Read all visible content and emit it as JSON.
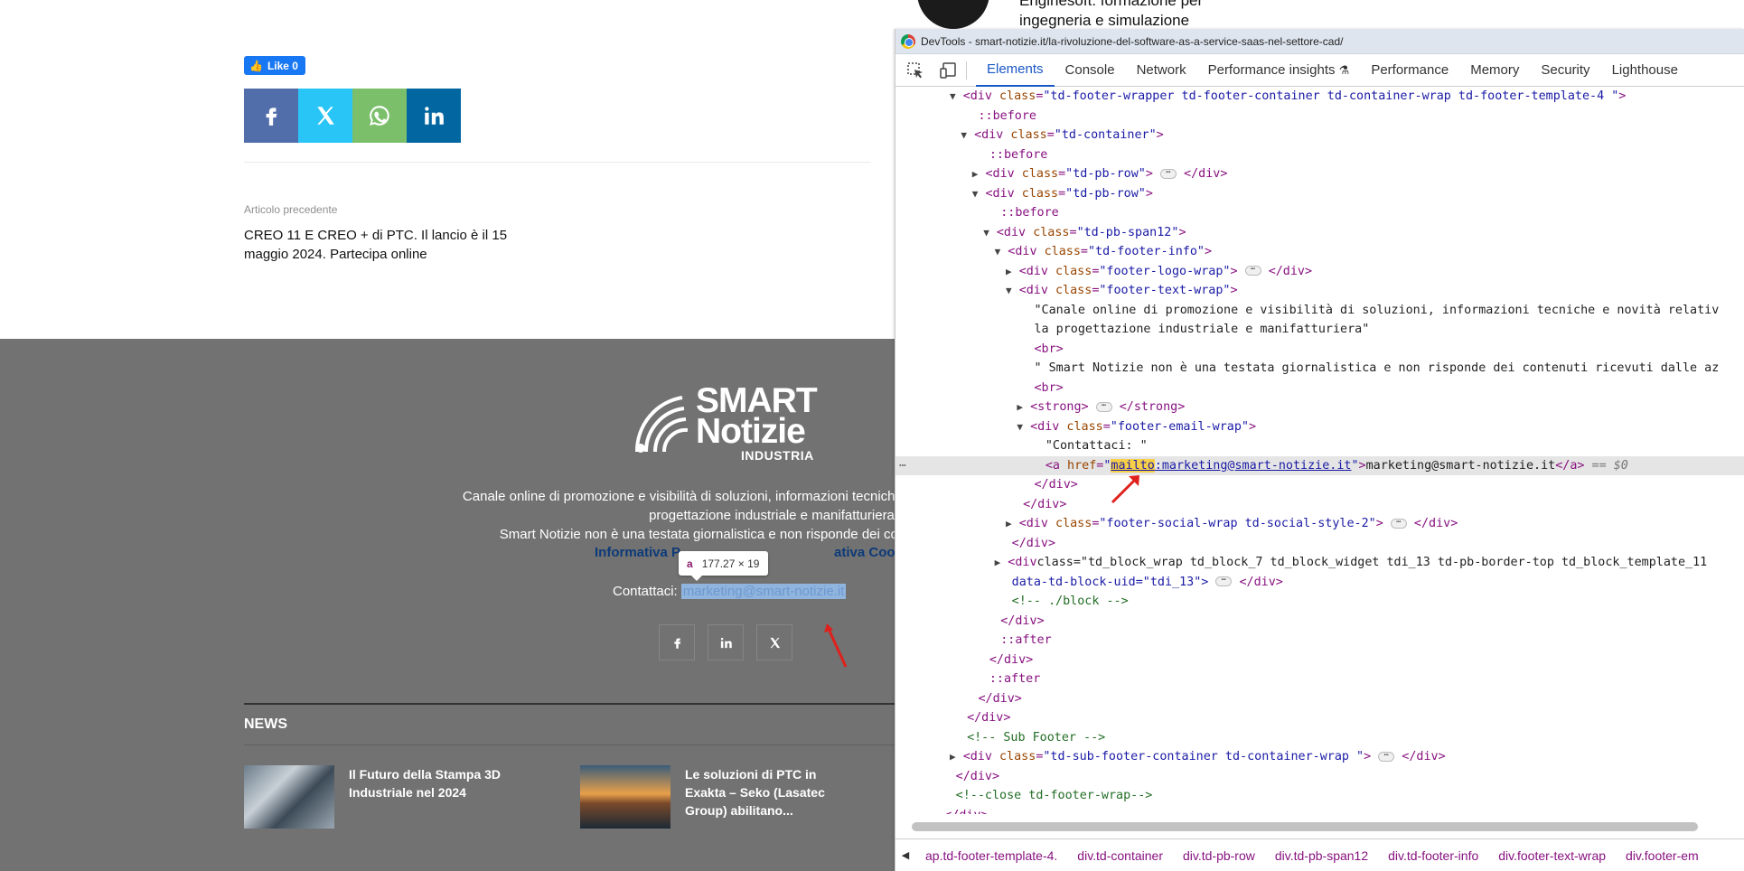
{
  "site": {
    "like_label": "Like 0",
    "prev_label": "Articolo precedente",
    "prev_title": "CREO 11 E CREO + di PTC. Il lancio è il 15 maggio 2024. Partecipa online",
    "ad_text": "Enginesoft: formazione per ingegneria e simulazione",
    "share_icons": [
      "facebook-icon",
      "x-icon",
      "whatsapp-icon",
      "linkedin-icon"
    ],
    "share_colors": [
      "#516eab",
      "#29c5f6",
      "#7bbf6a",
      "#0266a0"
    ]
  },
  "footer": {
    "logo_line1": "SMART",
    "logo_line2": "Notizie",
    "logo_line3": "INDUSTRIA",
    "line1": "Canale online di promozione e visibilità di soluzioni, informazioni tecniche e novità relative",
    "line2": "progettazione industriale e manifatturiera",
    "line3": "Smart Notizie non è una testata giornalistica e non risponde dei contenuti ricevut",
    "links": "Informativa P",
    "links_tail": "ativa Cookies",
    "contact_label": "Contattaci:",
    "contact_email": "marketing@smart-notizie.it",
    "tooltip_tag": "a",
    "tooltip_size": "177.27 × 19",
    "news_heading": "NEWS",
    "news": [
      {
        "title": "Il Futuro della Stampa 3D Industriale nel 2024"
      },
      {
        "title": "Le soluzioni di PTC in Exakta – Seko (Lasatec Group) abilitano..."
      }
    ]
  },
  "devtools": {
    "window_title": "DevTools - smart-notizie.it/la-rivoluzione-del-software-as-a-service-saas-nel-settore-cad/",
    "tabs": [
      "Elements",
      "Console",
      "Network",
      "Performance insights",
      "Performance",
      "Memory",
      "Security",
      "Lighthouse"
    ],
    "active_tab": "Elements",
    "breadcrumbs": [
      "ap.td-footer-template-4.",
      "div.td-container",
      "div.td-pb-row",
      "div.td-pb-span12",
      "div.td-footer-info",
      "div.footer-text-wrap",
      "div.footer-em"
    ],
    "lines": [
      {
        "indent": 0,
        "tri": "open",
        "html": "<div class=\"td-footer-wrapper td-footer-container td-container-wrap td-footer-template-4 \">"
      },
      {
        "indent": 1,
        "tri": "",
        "pseudo": "::before"
      },
      {
        "indent": 1,
        "tri": "open",
        "html": "<div class=\"td-container\">"
      },
      {
        "indent": 2,
        "tri": "",
        "pseudo": "::before"
      },
      {
        "indent": 2,
        "tri": "closed",
        "html": "<div class=\"td-pb-row\">",
        "ell": true,
        "close": "</div>"
      },
      {
        "indent": 2,
        "tri": "open",
        "html": "<div class=\"td-pb-row\">"
      },
      {
        "indent": 3,
        "tri": "",
        "pseudo": "::before"
      },
      {
        "indent": 3,
        "tri": "open",
        "html": "<div class=\"td-pb-span12\">"
      },
      {
        "indent": 4,
        "tri": "open",
        "html": "<div class=\"td-footer-info\">"
      },
      {
        "indent": 5,
        "tri": "closed",
        "html": "<div class=\"footer-logo-wrap\">",
        "ell": true,
        "close": "</div>"
      },
      {
        "indent": 5,
        "tri": "open",
        "html": "<div class=\"footer-text-wrap\">"
      },
      {
        "indent": 6,
        "tri": "",
        "text": "\"Canale online di promozione e visibilità di soluzioni, informazioni tecniche e novità relativ"
      },
      {
        "indent": 6,
        "tri": "",
        "text": "la progettazione industriale e manifatturiera\""
      },
      {
        "indent": 6,
        "tri": "",
        "html": "<br>"
      },
      {
        "indent": 6,
        "tri": "",
        "text": "\" Smart Notizie non è una testata giornalistica e non risponde dei contenuti ricevuti dalle az"
      },
      {
        "indent": 6,
        "tri": "",
        "html": "<br>"
      },
      {
        "indent": 6,
        "tri": "closed",
        "html": "<strong>",
        "ell": true,
        "close": "</strong>"
      },
      {
        "indent": 6,
        "tri": "open",
        "html": "<div class=\"footer-email-wrap\">"
      },
      {
        "indent": 7,
        "tri": "",
        "text": "\"Contattaci: \""
      },
      {
        "indent": 7,
        "tri": "",
        "anchor": true,
        "mailto": "mailto",
        "href_rest": ":marketing@smart-notizie.it",
        "link_text": "marketing@smart-notizie.it",
        "eq": "== $0"
      },
      {
        "indent": 6,
        "tri": "",
        "html": "</div>"
      },
      {
        "indent": 5,
        "tri": "",
        "html": "</div>"
      },
      {
        "indent": 5,
        "tri": "closed",
        "html": "<div class=\"footer-social-wrap td-social-style-2\">",
        "ell": true,
        "close": "</div>"
      },
      {
        "indent": 4,
        "tri": "",
        "html": "</div>"
      },
      {
        "indent": 4,
        "tri": "closed",
        "html": "<div class=\"td_block_wrap td_block_7 td_block_widget tdi_13 td-pb-border-top td_block_template_11"
      },
      {
        "indent": 4,
        "tri": "",
        "text2": "data-td-block-uid=\"tdi_13\">",
        "ell": true,
        "close": "</div>"
      },
      {
        "indent": 4,
        "tri": "",
        "comment": "<!-- ./block -->"
      },
      {
        "indent": 3,
        "tri": "",
        "html": "</div>"
      },
      {
        "indent": 3,
        "tri": "",
        "pseudo": "::after"
      },
      {
        "indent": 2,
        "tri": "",
        "html": "</div>"
      },
      {
        "indent": 2,
        "tri": "",
        "pseudo": "::after"
      },
      {
        "indent": 1,
        "tri": "",
        "html": "</div>"
      },
      {
        "indent": 0,
        "tri": "",
        "html": "</div>"
      },
      {
        "indent": 0,
        "tri": "",
        "comment": "<!-- Sub Footer -->"
      },
      {
        "indent": 0,
        "tri": "closed",
        "html": "<div class=\"td-sub-footer-container td-container-wrap \">",
        "ell": true,
        "close": "</div>"
      },
      {
        "indent": -1,
        "tri": "",
        "html": "</div>"
      },
      {
        "indent": -1,
        "tri": "",
        "comment": "<!--close td-footer-wrap-->"
      },
      {
        "indent": -2,
        "tri": "",
        "html": "</div>"
      }
    ],
    "selected_line": 19
  }
}
